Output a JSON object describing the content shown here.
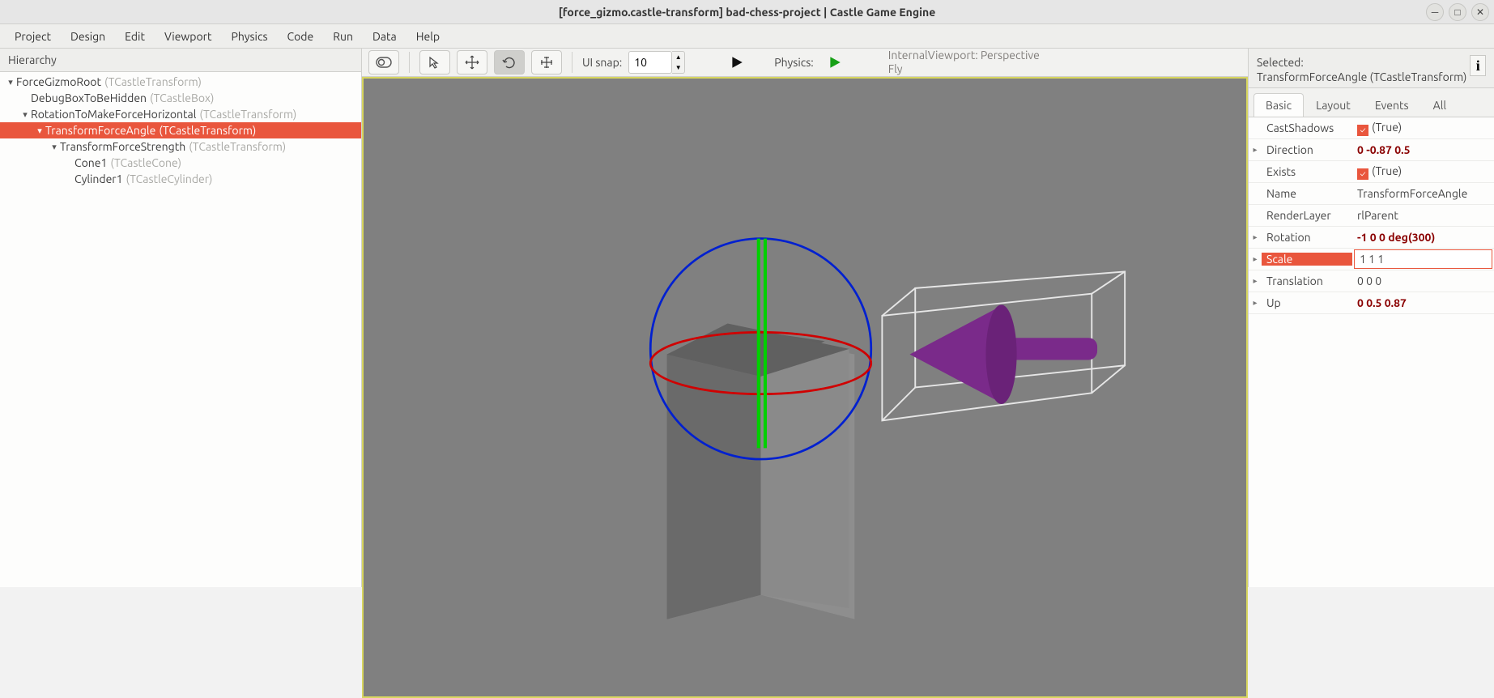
{
  "window": {
    "title": "[force_gizmo.castle-transform] bad-chess-project | Castle Game Engine"
  },
  "menu": {
    "items": [
      "Project",
      "Design",
      "Edit",
      "Viewport",
      "Physics",
      "Code",
      "Run",
      "Data",
      "Help"
    ]
  },
  "hierarchy": {
    "title": "Hierarchy",
    "nodes": [
      {
        "name": "ForceGizmoRoot",
        "type": "(TCastleTransform)",
        "depth": 0,
        "expanded": true
      },
      {
        "name": "DebugBoxToBeHidden",
        "type": "(TCastleBox)",
        "depth": 1,
        "leaf": true
      },
      {
        "name": "RotationToMakeForceHorizontal",
        "type": "(TCastleTransform)",
        "depth": 1,
        "expanded": true
      },
      {
        "name": "TransformForceAngle",
        "type": "(TCastleTransform)",
        "depth": 2,
        "expanded": true,
        "selected": true
      },
      {
        "name": "TransformForceStrength",
        "type": "(TCastleTransform)",
        "depth": 3,
        "expanded": true
      },
      {
        "name": "Cone1",
        "type": "(TCastleCone)",
        "depth": 4,
        "leaf": true
      },
      {
        "name": "Cylinder1",
        "type": "(TCastleCylinder)",
        "depth": 4,
        "leaf": true
      }
    ]
  },
  "toolbar": {
    "ui_snap_label": "UI snap:",
    "ui_snap_value": "10",
    "physics_label": "Physics:",
    "viewport_info_line1": "InternalViewport: Perspective",
    "viewport_info_line2": "Fly"
  },
  "inspector": {
    "selected_label": "Selected:",
    "selected_name": "TransformForceAngle (TCastleTransform)",
    "tabs": [
      "Basic",
      "Layout",
      "Events",
      "All"
    ],
    "active_tab": 0,
    "properties": [
      {
        "name": "CastShadows",
        "value": "(True)",
        "type": "bool",
        "checked": true
      },
      {
        "name": "Direction",
        "value": "0 -0.87 0.5",
        "type": "vec",
        "expandable": true,
        "bold": true
      },
      {
        "name": "Exists",
        "value": "(True)",
        "type": "bool",
        "checked": true
      },
      {
        "name": "Name",
        "value": "TransformForceAngle",
        "type": "text"
      },
      {
        "name": "RenderLayer",
        "value": "rlParent",
        "type": "text"
      },
      {
        "name": "Rotation",
        "value": "-1 0 0 deg(300)",
        "type": "vec",
        "expandable": true,
        "bold": true
      },
      {
        "name": "Scale",
        "value": "1 1 1",
        "type": "edit",
        "expandable": true,
        "active": true
      },
      {
        "name": "Translation",
        "value": "0 0 0",
        "type": "vec",
        "expandable": true
      },
      {
        "name": "Up",
        "value": "0 0.5 0.87",
        "type": "vec",
        "expandable": true,
        "bold": true
      }
    ]
  }
}
